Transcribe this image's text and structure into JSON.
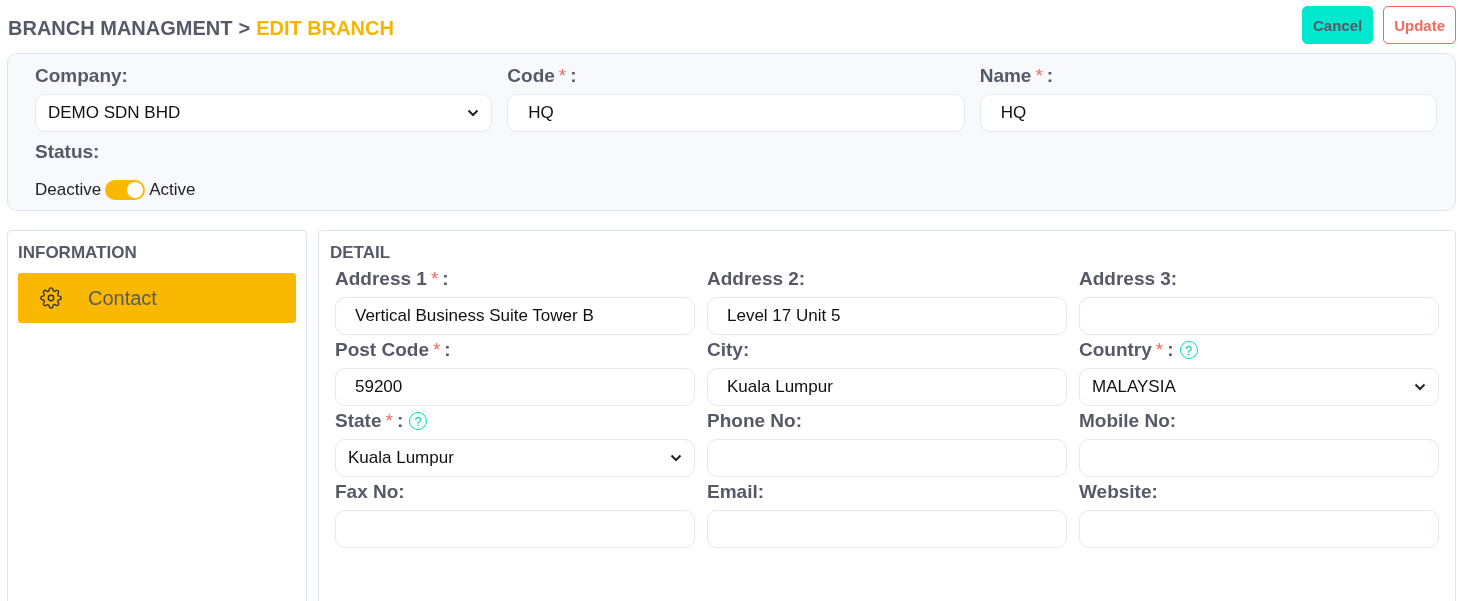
{
  "breadcrumb": {
    "parent": "BRANCH MANAGMENT",
    "separator": ">",
    "current": "EDIT BRANCH"
  },
  "buttons": [
    {
      "label": "Cancel",
      "kind": "primary"
    },
    {
      "label": "Update",
      "kind": "outline"
    }
  ],
  "general": {
    "fields": [
      {
        "label": "Company:",
        "kind": "select",
        "value": "DEMO SDN BHD"
      },
      {
        "label": "Code",
        "required_mark": "*",
        "label_end": ":",
        "kind": "text",
        "value": "HQ"
      },
      {
        "label": "Name",
        "required_mark": "*",
        "label_end": ":",
        "kind": "text",
        "value": "HQ"
      }
    ],
    "status": {
      "label": "Status:",
      "off_label": "Deactive",
      "on_label": "Active",
      "on": true
    }
  },
  "sidebar": {
    "title": "INFORMATION",
    "items": [
      {
        "label": "Contact",
        "selected": true
      }
    ]
  },
  "detail": {
    "title": "DETAIL",
    "fields": [
      {
        "label": "Address 1",
        "required_mark": "*",
        "label_end": ":",
        "kind": "text",
        "value": "Vertical Business Suite Tower B"
      },
      {
        "label": "Address 2:",
        "kind": "text",
        "value": "Level 17 Unit 5"
      },
      {
        "label": "Address 3:",
        "kind": "text"
      },
      {
        "label": "Post Code",
        "required_mark": "*",
        "label_end": ":",
        "kind": "text",
        "value": "59200"
      },
      {
        "label": "City:",
        "kind": "text",
        "value": "Kuala Lumpur"
      },
      {
        "label": "Country",
        "required_mark": "*",
        "label_end": ":",
        "help": "?",
        "kind": "select",
        "value": "MALAYSIA"
      },
      {
        "label": "State",
        "required_mark": "*",
        "label_end": ":",
        "help": "?",
        "kind": "select",
        "value": "Kuala Lumpur"
      },
      {
        "label": "Phone No:",
        "kind": "text"
      },
      {
        "label": "Mobile No:",
        "kind": "text"
      },
      {
        "label": "Fax No:",
        "kind": "text"
      },
      {
        "label": "Email:",
        "kind": "text"
      },
      {
        "label": "Website:",
        "kind": "text"
      }
    ]
  }
}
